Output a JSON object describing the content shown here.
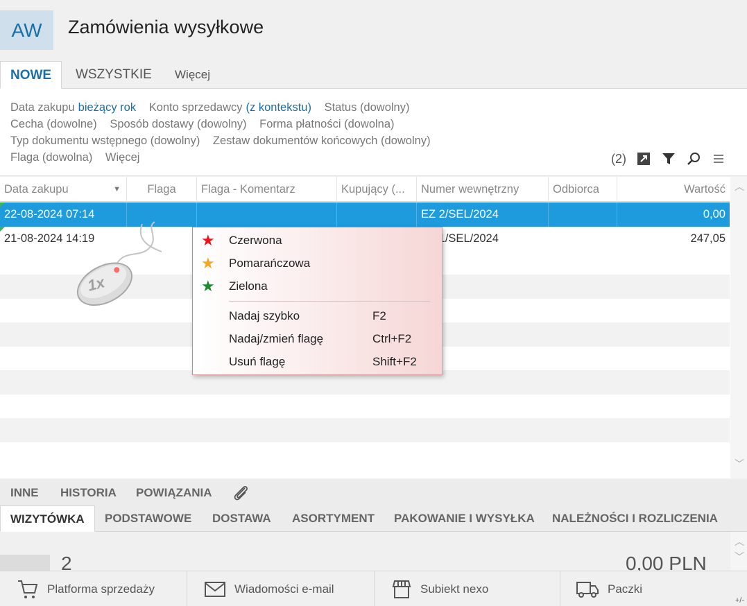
{
  "app": {
    "logo": "AW",
    "title": "Zamówienia wysyłkowe"
  },
  "tabs": [
    {
      "label": "NOWE"
    },
    {
      "label": "WSZYSTKIE"
    },
    {
      "label": "Więcej"
    }
  ],
  "filters": {
    "row1": {
      "a_label": "Data zakupu",
      "a_value": "bieżący rok",
      "b_label": "Konto sprzedawcy",
      "b_value": "(z kontekstu)",
      "c": "Status (dowolny)"
    },
    "row2": {
      "a": "Cecha (dowolne)",
      "b": "Sposób dostawy (dowolny)",
      "c": "Forma płatności (dowolna)"
    },
    "row3": {
      "a": "Typ dokumentu wstępnego (dowolny)",
      "b": "Zestaw dokumentów końcowych (dowolny)"
    },
    "row4": {
      "a": "Flaga (dowolna)",
      "b": "Więcej"
    },
    "count": "(2)"
  },
  "grid": {
    "columns": [
      "Data zakupu",
      "Flaga",
      "Flaga - Komentarz",
      "Kupujący (...",
      "Numer wewnętrzny",
      "Odbiorca",
      "Wartość"
    ],
    "rows": [
      {
        "date": "22-08-2024 07:14",
        "flag": "",
        "comment": "",
        "buyer": "",
        "number": "EZ 2/SEL/2024",
        "recipient": "",
        "value": "0,00"
      },
      {
        "date": "21-08-2024 14:19",
        "flag": "",
        "comment": "",
        "buyer": "",
        "number": "EZ 1/SEL/2024",
        "recipient": "",
        "value": "247,05"
      }
    ]
  },
  "context_menu": {
    "items": [
      {
        "label": "Czerwona",
        "color": "#e8141b"
      },
      {
        "label": "Pomarańczowa",
        "color": "#f5a623"
      },
      {
        "label": "Zielona",
        "color": "#1e8a2e"
      }
    ],
    "actions": [
      {
        "label": "Nadaj szybko",
        "key": "F2"
      },
      {
        "label": "Nadaj/zmień flagę",
        "key": "Ctrl+F2"
      },
      {
        "label": "Usuń flagę",
        "key": "Shift+F2"
      }
    ]
  },
  "mouse_hint": "1x",
  "bottom_tabs_top": [
    "INNE",
    "HISTORIA",
    "POWIĄZANIA"
  ],
  "bottom_tabs": [
    "WIZYTÓWKA",
    "PODSTAWOWE",
    "DOSTAWA",
    "ASORTYMENT",
    "PAKOWANIE I WYSYŁKA",
    "NALEŻNOŚCI I ROZLICZENIA"
  ],
  "detail": {
    "count": "2",
    "amount": "0,00 PLN"
  },
  "footer": [
    {
      "label": "Platforma sprzedaży"
    },
    {
      "label": "Wiadomości e-mail"
    },
    {
      "label": "Subiekt nexo"
    },
    {
      "label": "Paczki"
    }
  ],
  "footer_corner": "+/-"
}
